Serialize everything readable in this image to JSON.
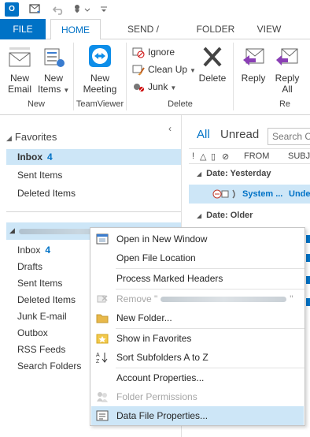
{
  "quick_access": {
    "logo_text": "O",
    "icons": [
      "outlook-logo-icon",
      "send-receive-icon",
      "undo-icon",
      "touch-mode-icon",
      "customize-toolbar-icon"
    ]
  },
  "tabs": [
    {
      "label": "FILE"
    },
    {
      "label": "HOME"
    },
    {
      "label": "SEND / RECEIVE"
    },
    {
      "label": "FOLDER"
    },
    {
      "label": "VIEW"
    }
  ],
  "ribbon": {
    "new_email_1": "New",
    "new_email_2": "Email",
    "new_items_1": "New",
    "new_items_2": "Items",
    "group_new": "New",
    "new_meeting_1": "New",
    "new_meeting_2": "Meeting",
    "group_teamviewer": "TeamViewer",
    "ignore": "Ignore",
    "clean_up": "Clean Up",
    "junk": "Junk",
    "delete": "Delete",
    "group_delete": "Delete",
    "reply": "Reply",
    "reply_all_1": "Reply",
    "reply_all_2": "All",
    "group_respond": "Re"
  },
  "folder_pane": {
    "favorites_label": "Favorites",
    "favorites": [
      {
        "label": "Inbox",
        "count": "4"
      },
      {
        "label": "Sent Items",
        "count": ""
      },
      {
        "label": "Deleted Items",
        "count": ""
      }
    ],
    "account_folders": [
      {
        "label": "Inbox",
        "count": "4"
      },
      {
        "label": "Drafts",
        "count": ""
      },
      {
        "label": "Sent Items",
        "count": ""
      },
      {
        "label": "Deleted Items",
        "count": ""
      },
      {
        "label": "Junk E-mail",
        "count": ""
      },
      {
        "label": "Outbox",
        "count": ""
      },
      {
        "label": "RSS Feeds",
        "count": ""
      },
      {
        "label": "Search Folders",
        "count": ""
      }
    ]
  },
  "message_list": {
    "filter_all": "All",
    "filter_unread": "Unread",
    "search_placeholder": "Search Cu",
    "col_from": "FROM",
    "col_subject": "SUBJE",
    "group_yesterday": "Date: Yesterday",
    "group_older": "Date: Older",
    "msg_sender": "System ...",
    "msg_subject": "Unde"
  },
  "context_menu": {
    "open_new_window": "Open in New Window",
    "open_file_location": "Open File Location",
    "process_marked_headers": "Process Marked Headers",
    "remove_prefix": "Remove \"",
    "remove_suffix": "\"",
    "new_folder": "New Folder...",
    "show_in_favorites": "Show in Favorites",
    "sort_subfolders": "Sort Subfolders A to Z",
    "account_properties": "Account Properties...",
    "folder_permissions": "Folder Permissions",
    "data_file_properties": "Data File Properties..."
  },
  "colors": {
    "accent": "#0072c6",
    "selection": "#cde6f7"
  }
}
